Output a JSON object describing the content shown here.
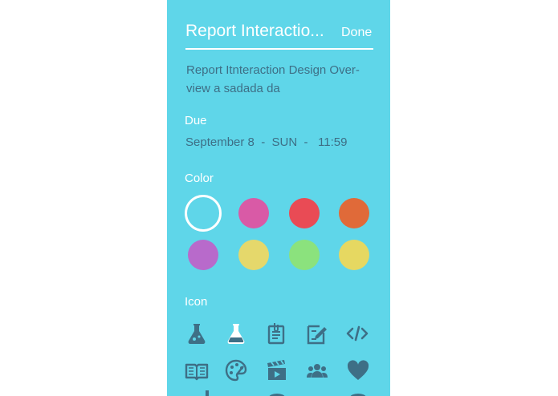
{
  "header": {
    "title": "Report Interactio...",
    "done_label": "Done"
  },
  "description": "Report Itnteraction Design Over-view a sadada  da",
  "due": {
    "label": "Due",
    "value": "September 8  -  SUN  -   11:59"
  },
  "color": {
    "label": "Color",
    "swatches": [
      "#ffffff",
      "#d95aa6",
      "#e94b55",
      "#e06a39",
      "#b86acb",
      "#e5d86b",
      "#8be27d",
      "#e6d861"
    ],
    "selected_index": 0
  },
  "icon": {
    "label": "Icon",
    "items": [
      "flask-icon",
      "flask-outline-icon",
      "clipboard-paperclip-icon",
      "edit-document-icon",
      "code-icon",
      "open-book-icon",
      "palette-icon",
      "clapperboard-icon",
      "people-group-icon",
      "heart-icon"
    ]
  },
  "colors": {
    "background": "#5fd6e9",
    "text_dark": "#3e6f86",
    "text_light": "#ffffff"
  }
}
